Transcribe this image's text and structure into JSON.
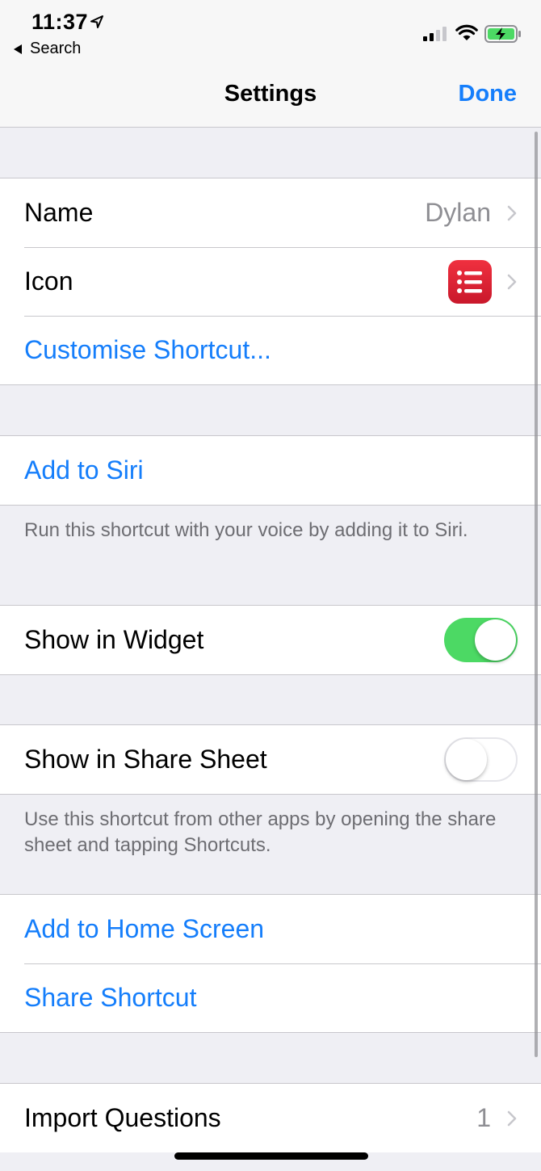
{
  "status_bar": {
    "time": "11:37",
    "back_label": "Search"
  },
  "nav": {
    "title": "Settings",
    "done_label": "Done"
  },
  "colors": {
    "accent": "#157efb",
    "toggle_on": "#4cd964",
    "icon_red": "#e32036"
  },
  "group1": {
    "name_label": "Name",
    "name_value": "Dylan",
    "icon_label": "Icon",
    "icon_name": "list-icon",
    "customise_label": "Customise Shortcut..."
  },
  "siri": {
    "add_label": "Add to Siri",
    "footer": "Run this shortcut with your voice by adding it to Siri."
  },
  "widget": {
    "label": "Show in Widget",
    "enabled": true
  },
  "share_sheet": {
    "label": "Show in Share Sheet",
    "enabled": false,
    "footer": "Use this shortcut from other apps by opening the share sheet and tapping Shortcuts."
  },
  "actions": {
    "home_screen_label": "Add to Home Screen",
    "share_label": "Share Shortcut"
  },
  "import": {
    "label": "Import Questions",
    "count": "1"
  }
}
